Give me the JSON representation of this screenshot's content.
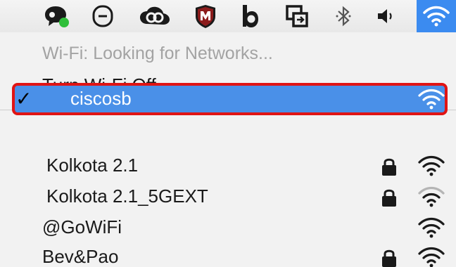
{
  "menubar": {
    "icons": [
      "chat-status-icon",
      "minus-circle-icon",
      "creative-cloud-icon",
      "mcafee-shield-icon",
      "b-app-icon",
      "screen-share-icon",
      "bluetooth-icon",
      "volume-icon",
      "wifi-icon"
    ]
  },
  "wifi_menu": {
    "status": "Wi-Fi: Looking for Networks...",
    "toggle_label": "Turn Wi-Fi Off",
    "networks": [
      {
        "name": "ciscosb",
        "connected": true,
        "secured": false,
        "signal": "strong"
      },
      {
        "name": "Kolkota 2.1",
        "connected": false,
        "secured": true,
        "signal": "strong"
      },
      {
        "name": "Kolkota 2.1_5GEXT",
        "connected": false,
        "secured": true,
        "signal": "weak"
      },
      {
        "name": "@GoWiFi",
        "connected": false,
        "secured": false,
        "signal": "strong"
      },
      {
        "name": "Bev&Pao",
        "connected": false,
        "secured": true,
        "signal": "strong"
      }
    ],
    "check_mark": "✓"
  },
  "colors": {
    "selection": "#4a90e8",
    "highlight_border": "#e01414",
    "menubar_wifi_bg": "#3b8bf0",
    "disabled_text": "#a3a3a3"
  }
}
